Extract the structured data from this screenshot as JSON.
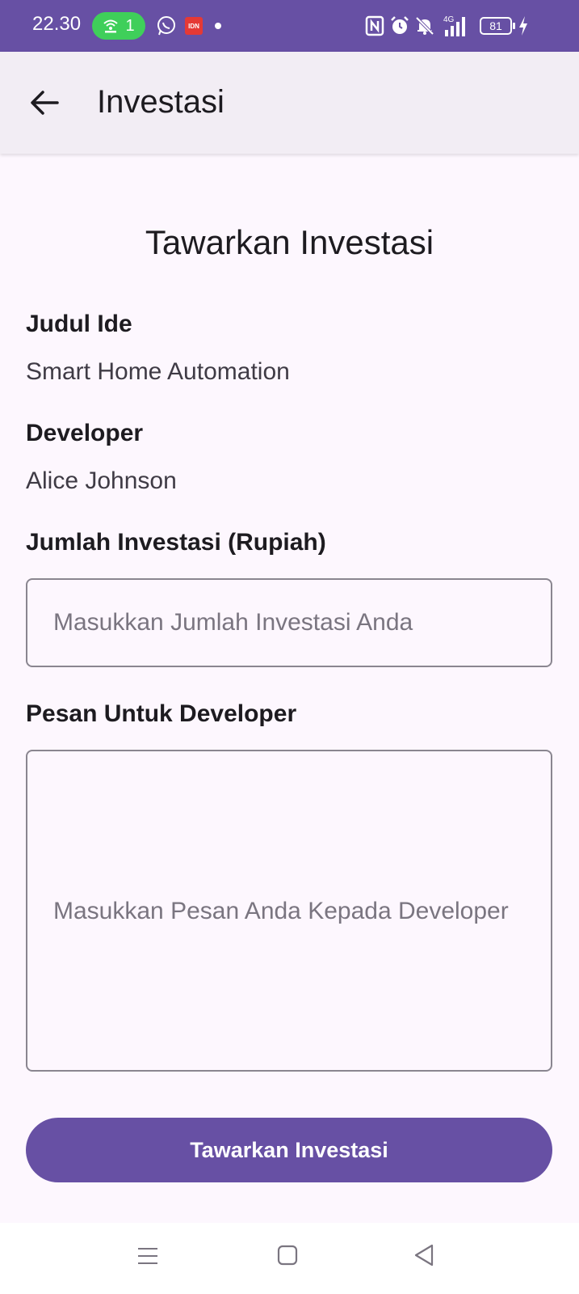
{
  "status_bar": {
    "time": "22.30",
    "hotspot_count": "1",
    "battery": "81",
    "icons": [
      "hotspot-icon",
      "whatsapp-icon",
      "idn-app-icon",
      "notification-dot-icon",
      "nfc-icon",
      "alarm-icon",
      "mute-icon",
      "signal-4g-icon",
      "battery-icon",
      "charging-icon"
    ],
    "idn_label": "IDN",
    "network_label": "4G"
  },
  "app_bar": {
    "title": "Investasi",
    "back_icon": "arrow-left-icon"
  },
  "form": {
    "heading": "Tawarkan Investasi",
    "idea_title_label": "Judul Ide",
    "idea_title_value": "Smart Home Automation",
    "developer_label": "Developer",
    "developer_value": "Alice Johnson",
    "amount_label": "Jumlah Investasi (Rupiah)",
    "amount_value": "",
    "amount_placeholder": "Masukkan Jumlah Investasi Anda",
    "message_label": "Pesan Untuk Developer",
    "message_value": "",
    "message_placeholder": "Masukkan Pesan Anda Kepada Developer",
    "submit_label": "Tawarkan Investasi"
  },
  "nav_bar": {
    "icons": [
      "menu-icon",
      "home-icon",
      "back-triangle-icon"
    ]
  },
  "colors": {
    "primary": "#6750a4",
    "background": "#fdf7fe",
    "app_bar": "#f2edf4",
    "hotspot": "#3fcf5a"
  }
}
